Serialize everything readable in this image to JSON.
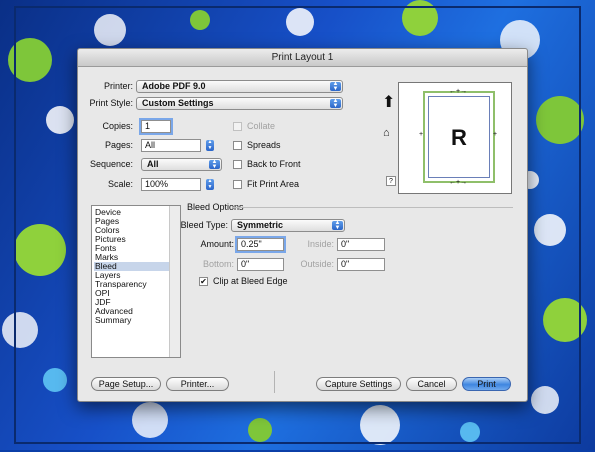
{
  "window": {
    "title": "Print Layout 1"
  },
  "printer": {
    "label": "Printer:",
    "value": "Adobe PDF 9.0"
  },
  "print_style": {
    "label": "Print Style:",
    "value": "Custom Settings"
  },
  "copies": {
    "label": "Copies:",
    "value": "1"
  },
  "pages": {
    "label": "Pages:",
    "value": "All"
  },
  "sequence": {
    "label": "Sequence:",
    "value": "All"
  },
  "scale": {
    "label": "Scale:",
    "value": "100%"
  },
  "checkboxes": {
    "collate": {
      "label": "Collate",
      "checked": false,
      "enabled": false
    },
    "spreads": {
      "label": "Spreads",
      "checked": false,
      "enabled": true
    },
    "back_to_front": {
      "label": "Back to Front",
      "checked": false,
      "enabled": true
    },
    "fit_print_area": {
      "label": "Fit Print Area",
      "checked": false,
      "enabled": true
    },
    "clip_at_bleed_edge": {
      "label": "Clip at Bleed Edge",
      "checked": true,
      "enabled": true
    }
  },
  "preview": {
    "letter": "R",
    "help": "?"
  },
  "nav": {
    "items": [
      "Device",
      "Pages",
      "Colors",
      "Pictures",
      "Fonts",
      "Marks",
      "Bleed",
      "Layers",
      "Transparency",
      "OPI",
      "JDF",
      "Advanced",
      "Summary"
    ],
    "selected": "Bleed"
  },
  "bleed": {
    "section_title": "Bleed Options",
    "type_label": "Bleed Type:",
    "type_value": "Symmetric",
    "amount_label": "Amount:",
    "amount_value": "0.25\"",
    "inside_label": "Inside:",
    "inside_value": "0\"",
    "bottom_label": "Bottom:",
    "bottom_value": "0\"",
    "outside_label": "Outside:",
    "outside_value": "0\""
  },
  "buttons": {
    "page_setup": "Page Setup...",
    "printer": "Printer...",
    "capture_settings": "Capture Settings",
    "cancel": "Cancel",
    "print": "Print"
  },
  "colors": {
    "accent": "#3f86e0",
    "selection": "#c7d5ea",
    "bleed_guide": "#8fbf6a"
  }
}
